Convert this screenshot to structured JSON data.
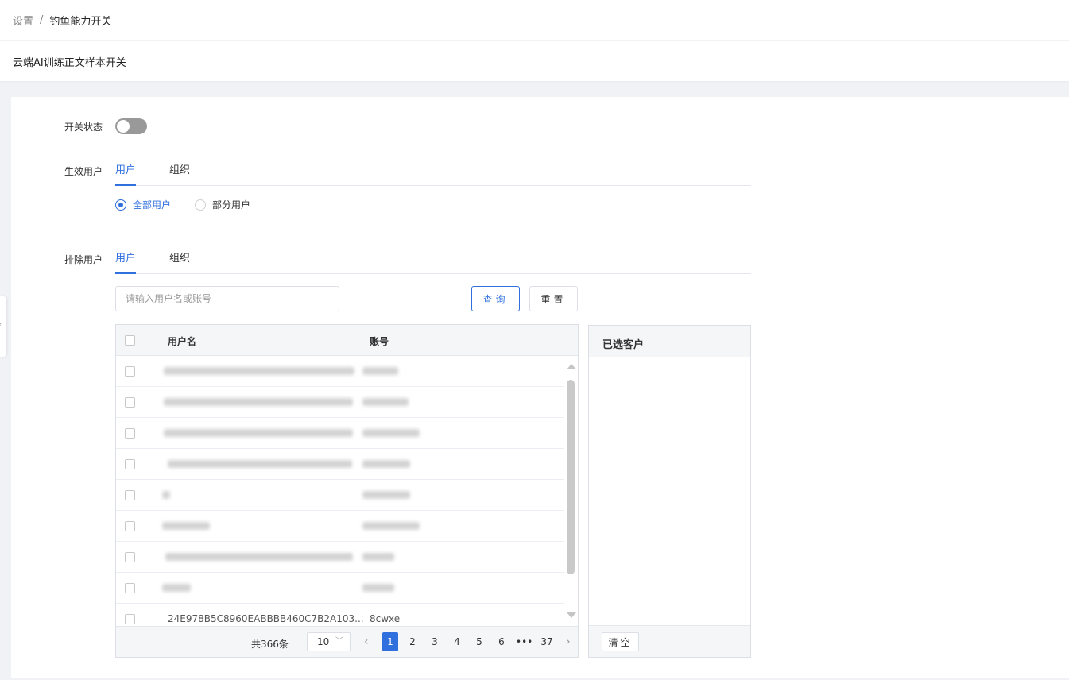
{
  "breadcrumb": {
    "parent": "设置",
    "separator": "/",
    "current": "钓鱼能力开关"
  },
  "page_title": "云端AI训练正文样本开关",
  "switch": {
    "label": "开关状态",
    "state": "off"
  },
  "effective_users": {
    "label": "生效用户",
    "tabs": [
      "用户",
      "组织"
    ],
    "active_tab": "用户",
    "options": [
      "全部用户",
      "部分用户"
    ],
    "selected_option": "全部用户"
  },
  "excluded_users": {
    "label": "排除用户",
    "tabs": [
      "用户",
      "组织"
    ],
    "active_tab": "用户",
    "search_placeholder": "请输入用户名或账号",
    "query_label": "查询",
    "reset_label": "重置"
  },
  "table": {
    "columns": [
      "用户名",
      "账号"
    ],
    "last_row": {
      "username": "24E978B5C8960EABBBB460C7B2A103...",
      "account": "8cwxe"
    }
  },
  "pagination": {
    "total": "共366条",
    "page_size": "10",
    "pages": [
      "1",
      "2",
      "3",
      "4",
      "5",
      "6",
      "•••",
      "37"
    ],
    "current": "1"
  },
  "selected_panel": {
    "title": "已选客户",
    "clear_label": "清空"
  },
  "colors": {
    "accent": "#2f6fde",
    "toggle_off": "#999999",
    "background": "#f0f2f5"
  }
}
